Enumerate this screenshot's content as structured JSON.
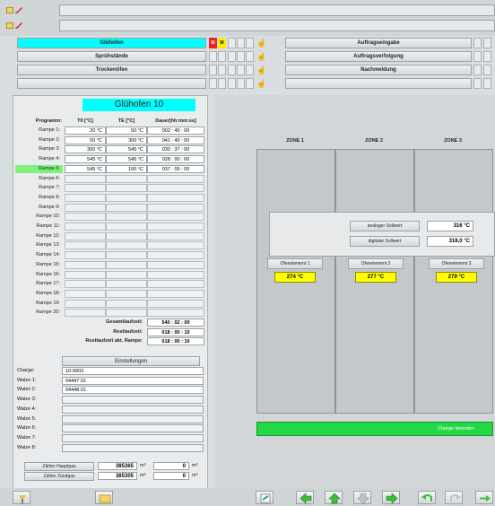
{
  "topbar": {
    "icons": [
      "folder-icon",
      "pencil-icon"
    ]
  },
  "menu_left": [
    {
      "label": "Glühofen",
      "active": true
    },
    {
      "label": "Sprühstände",
      "active": false
    },
    {
      "label": "Trockenöfen",
      "active": false
    },
    {
      "label": "",
      "active": false
    }
  ],
  "menu_right": [
    {
      "label": "Auftragseingabe"
    },
    {
      "label": "Auftragsverfolgung"
    },
    {
      "label": "Nachmeldung"
    },
    {
      "label": ""
    }
  ],
  "status_markers": {
    "red": "M",
    "yellow": "M"
  },
  "oven": {
    "title": "Glühofen 10",
    "columns": [
      "Programm:",
      "T0 [°C]",
      "TE [°C]",
      "Dauer[hh:mm:ss]"
    ],
    "ramps": [
      {
        "label": "Rampe 1:",
        "t0": "20 °C",
        "te": "50 °C",
        "dur": "002 : 40 : 00"
      },
      {
        "label": "Rampe 2:",
        "t0": "50 °C",
        "te": "300 °C",
        "dur": "041 : 40 : 00"
      },
      {
        "label": "Rampe 3:",
        "t0": "300 °C",
        "te": "545 °C",
        "dur": "030 : 37 : 00"
      },
      {
        "label": "Rampe 4:",
        "t0": "545 °C",
        "te": "545 °C",
        "dur": "028 : 00 : 00"
      },
      {
        "label": "Rampe 5:",
        "t0": "545 °C",
        "te": "100 °C",
        "dur": "037 : 05 : 00",
        "active": true
      },
      {
        "label": "Rampe 6:"
      },
      {
        "label": "Rampe 7:"
      },
      {
        "label": "Rampe 8:"
      },
      {
        "label": "Rampe 9:"
      },
      {
        "label": "Rampe 10:"
      },
      {
        "label": "Rampe 11:"
      },
      {
        "label": "Rampe 12:"
      },
      {
        "label": "Rampe 13:"
      },
      {
        "label": "Rampe 14:"
      },
      {
        "label": "Rampe 15:"
      },
      {
        "label": "Rampe 16:"
      },
      {
        "label": "Rampe 17:"
      },
      {
        "label": "Rampe 18:"
      },
      {
        "label": "Rampe 19:"
      },
      {
        "label": "Rampe 20:"
      }
    ],
    "totals": [
      {
        "label": "Gesamtlaufzeit:",
        "value": "540 : 02 : 00"
      },
      {
        "label": "Restlaufzeit:",
        "value": "018 : 00 : 10"
      },
      {
        "label": "Restlaufzeit akt. Rampe:",
        "value": "018 : 00 : 10"
      }
    ],
    "settings_label": "Einstellungen"
  },
  "charge": {
    "rows": [
      {
        "label": "Charge:",
        "value": "10-0003"
      },
      {
        "label": "Walze 1:",
        "value": "04447.01"
      },
      {
        "label": "Walze 2:",
        "value": "04448.01"
      },
      {
        "label": "Walze 3:",
        "value": ""
      },
      {
        "label": "Walze 4:",
        "value": ""
      },
      {
        "label": "Walze 5:",
        "value": ""
      },
      {
        "label": "Walze 6:",
        "value": ""
      },
      {
        "label": "Walze 7:",
        "value": ""
      },
      {
        "label": "Walze 8:",
        "value": ""
      }
    ]
  },
  "counters": [
    {
      "label": "Zähler Hauptgas",
      "value": "385365",
      "unit": "m³",
      "value2": "0",
      "unit2": "m³"
    },
    {
      "label": "Zähler Zündgas",
      "value": "385305",
      "unit": "m³",
      "value2": "0",
      "unit2": "m³"
    }
  ],
  "zones": {
    "headers": [
      "ZONE 1",
      "ZONE 2",
      "ZONE 3"
    ],
    "analog_label": "analoger Sollwert",
    "analog_value": "316 °C",
    "digital_label": "digitaler Sollwert",
    "digital_value": "318,0 °C",
    "elements": [
      {
        "label": "Ofenelement 1",
        "value": "274 °C"
      },
      {
        "label": "Ofenelement 2",
        "value": "277 °C"
      },
      {
        "label": "Ofenelement 3",
        "value": "279 °C"
      }
    ],
    "charge_button": "Charge beenden"
  },
  "colors": {
    "cyan": "#00ffff",
    "green": "#22d845",
    "yellow": "#ffff00"
  },
  "toolbar_icons": [
    "pin-icon",
    "folder-icon",
    "refresh-icon",
    "arrow-left-icon",
    "arrow-up-icon",
    "arrow-down-icon",
    "arrow-right-icon",
    "undo-icon",
    "redo-icon",
    "exit-icon"
  ]
}
